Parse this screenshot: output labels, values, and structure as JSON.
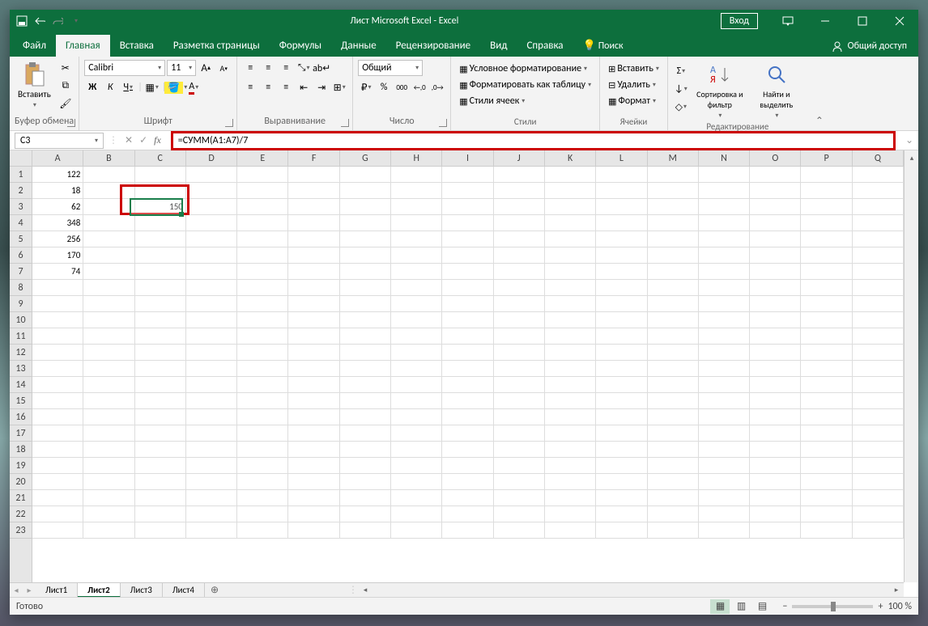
{
  "title": "Лист Microsoft Excel - Excel",
  "signIn": "Вход",
  "tabs": [
    "Файл",
    "Главная",
    "Вставка",
    "Разметка страницы",
    "Формулы",
    "Данные",
    "Рецензирование",
    "Вид",
    "Справка"
  ],
  "activeTab": 1,
  "search": "Поиск",
  "share": "Общий доступ",
  "groups": {
    "clipboard": {
      "paste": "Вставить",
      "label": "Буфер обмена"
    },
    "font": {
      "name": "Calibri",
      "size": "11",
      "label": "Шрифт",
      "bold": "Ж",
      "italic": "К",
      "underline": "Ч"
    },
    "align": {
      "label": "Выравнивание"
    },
    "number": {
      "format": "Общий",
      "label": "Число"
    },
    "styles": {
      "cond": "Условное форматирование",
      "table": "Форматировать как таблицу",
      "cell": "Стили ячеек",
      "label": "Стили"
    },
    "cells": {
      "insert": "Вставить",
      "delete": "Удалить",
      "format": "Формат",
      "label": "Ячейки"
    },
    "editing": {
      "sort": "Сортировка и фильтр",
      "find": "Найти и выделить",
      "label": "Редактирование"
    }
  },
  "nameBox": "C3",
  "formula": "=СУММ(A1:A7)/7",
  "columns": [
    "A",
    "B",
    "C",
    "D",
    "E",
    "F",
    "G",
    "H",
    "I",
    "J",
    "K",
    "L",
    "M",
    "N",
    "O",
    "P",
    "Q"
  ],
  "rowCount": 23,
  "data": {
    "A": [
      "122",
      "18",
      "62",
      "348",
      "256",
      "170",
      "74"
    ],
    "C3": "150"
  },
  "sheets": [
    "Лист1",
    "Лист2",
    "Лист3",
    "Лист4"
  ],
  "activeSheet": 1,
  "status": "Готово",
  "zoom": "100 %"
}
